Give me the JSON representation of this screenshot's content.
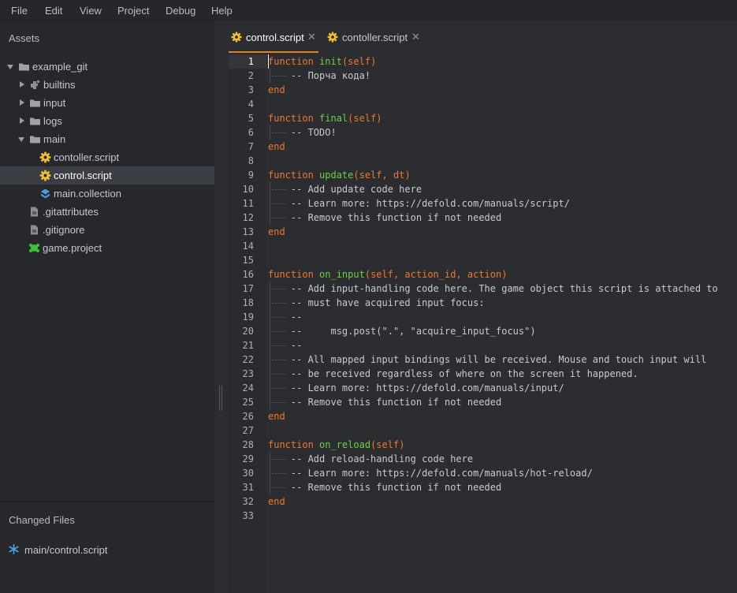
{
  "menu": [
    "File",
    "Edit",
    "View",
    "Project",
    "Debug",
    "Help"
  ],
  "assets": {
    "header": "Assets",
    "tree": [
      {
        "label": "example_git",
        "type": "folder",
        "expanded": true,
        "depth": 0
      },
      {
        "label": "builtins",
        "type": "builtins",
        "expanded": false,
        "depth": 1
      },
      {
        "label": "input",
        "type": "folder",
        "expanded": false,
        "depth": 1
      },
      {
        "label": "logs",
        "type": "folder",
        "expanded": false,
        "depth": 1
      },
      {
        "label": "main",
        "type": "folder",
        "expanded": true,
        "depth": 1
      },
      {
        "label": "contoller.script",
        "type": "script",
        "depth": 2
      },
      {
        "label": "control.script",
        "type": "script",
        "depth": 2,
        "selected": true
      },
      {
        "label": "main.collection",
        "type": "collection",
        "depth": 2
      },
      {
        "label": ".gitattributes",
        "type": "file",
        "depth": 1
      },
      {
        "label": ".gitignore",
        "type": "file",
        "depth": 1
      },
      {
        "label": "game.project",
        "type": "project",
        "depth": 1
      }
    ]
  },
  "changed_files": {
    "header": "Changed Files",
    "items": [
      "main/control.script"
    ]
  },
  "tabs": [
    {
      "label": "control.script",
      "active": true,
      "icon": "gear-script-icon"
    },
    {
      "label": "contoller.script",
      "active": false,
      "icon": "gear-script-icon"
    }
  ],
  "editor": {
    "current_line": 1,
    "lines": [
      "function init(self)",
      "\t-- Порча кода!",
      "end",
      "",
      "function final(self)",
      "\t-- TODO!",
      "end",
      "",
      "function update(self, dt)",
      "\t-- Add update code here",
      "\t-- Learn more: https://defold.com/manuals/script/",
      "\t-- Remove this function if not needed",
      "end",
      "",
      "",
      "function on_input(self, action_id, action)",
      "\t-- Add input-handling code here. The game object this script is attached to",
      "\t-- must have acquired input focus:",
      "\t--",
      "\t--     msg.post(\".\", \"acquire_input_focus\")",
      "\t--",
      "\t-- All mapped input bindings will be received. Mouse and touch input will",
      "\t-- be received regardless of where on the screen it happened.",
      "\t-- Learn more: https://defold.com/manuals/input/",
      "\t-- Remove this function if not needed",
      "end",
      "",
      "function on_reload(self)",
      "\t-- Add reload-handling code here",
      "\t-- Learn more: https://defold.com/manuals/hot-reload/",
      "\t-- Remove this function if not needed",
      "end",
      ""
    ]
  },
  "colors": {
    "keyword": "#f0782c",
    "function_name": "#6ecf46",
    "accent_tab": "#e0801f",
    "script_icon": "#f2c230",
    "collection_icon": "#4a9fe0",
    "project_icon": "#3fbf3a"
  }
}
